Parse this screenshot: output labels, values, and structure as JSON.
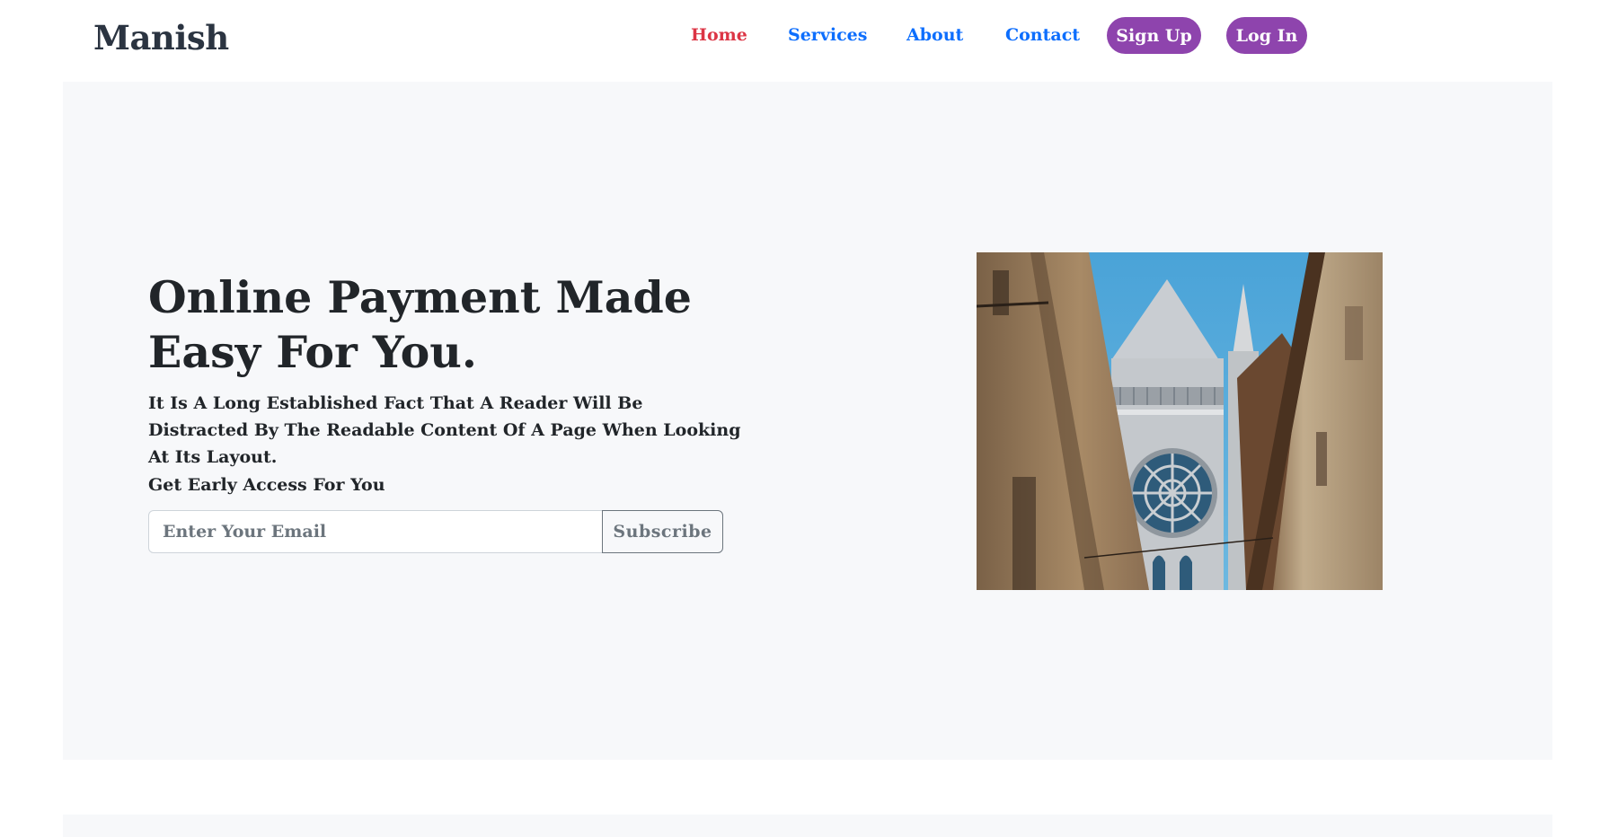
{
  "navbar": {
    "brand": "Manish",
    "links": [
      {
        "label": "Home",
        "active": true
      },
      {
        "label": "Services",
        "active": false
      },
      {
        "label": "About",
        "active": false
      },
      {
        "label": "Contact",
        "active": false
      }
    ],
    "signup_label": "Sign Up",
    "login_label": "Log In"
  },
  "hero": {
    "title": "Online Payment Made Easy For You.",
    "subtitle": "It Is A Long Established Fact That A Reader Will Be Distracted By The Readable Content Of A Page When Looking At Its Layout.",
    "access_label": "Get Early Access For You",
    "email_placeholder": "Enter Your Email",
    "subscribe_label": "Subscribe",
    "image_subject": "cathedral-alley-photo"
  },
  "colors": {
    "brand_text": "#2b3441",
    "active_link": "#dc3545",
    "link": "#0d6efd",
    "pill_button": "#8e44ad",
    "hero_background": "#f7f8fa"
  }
}
